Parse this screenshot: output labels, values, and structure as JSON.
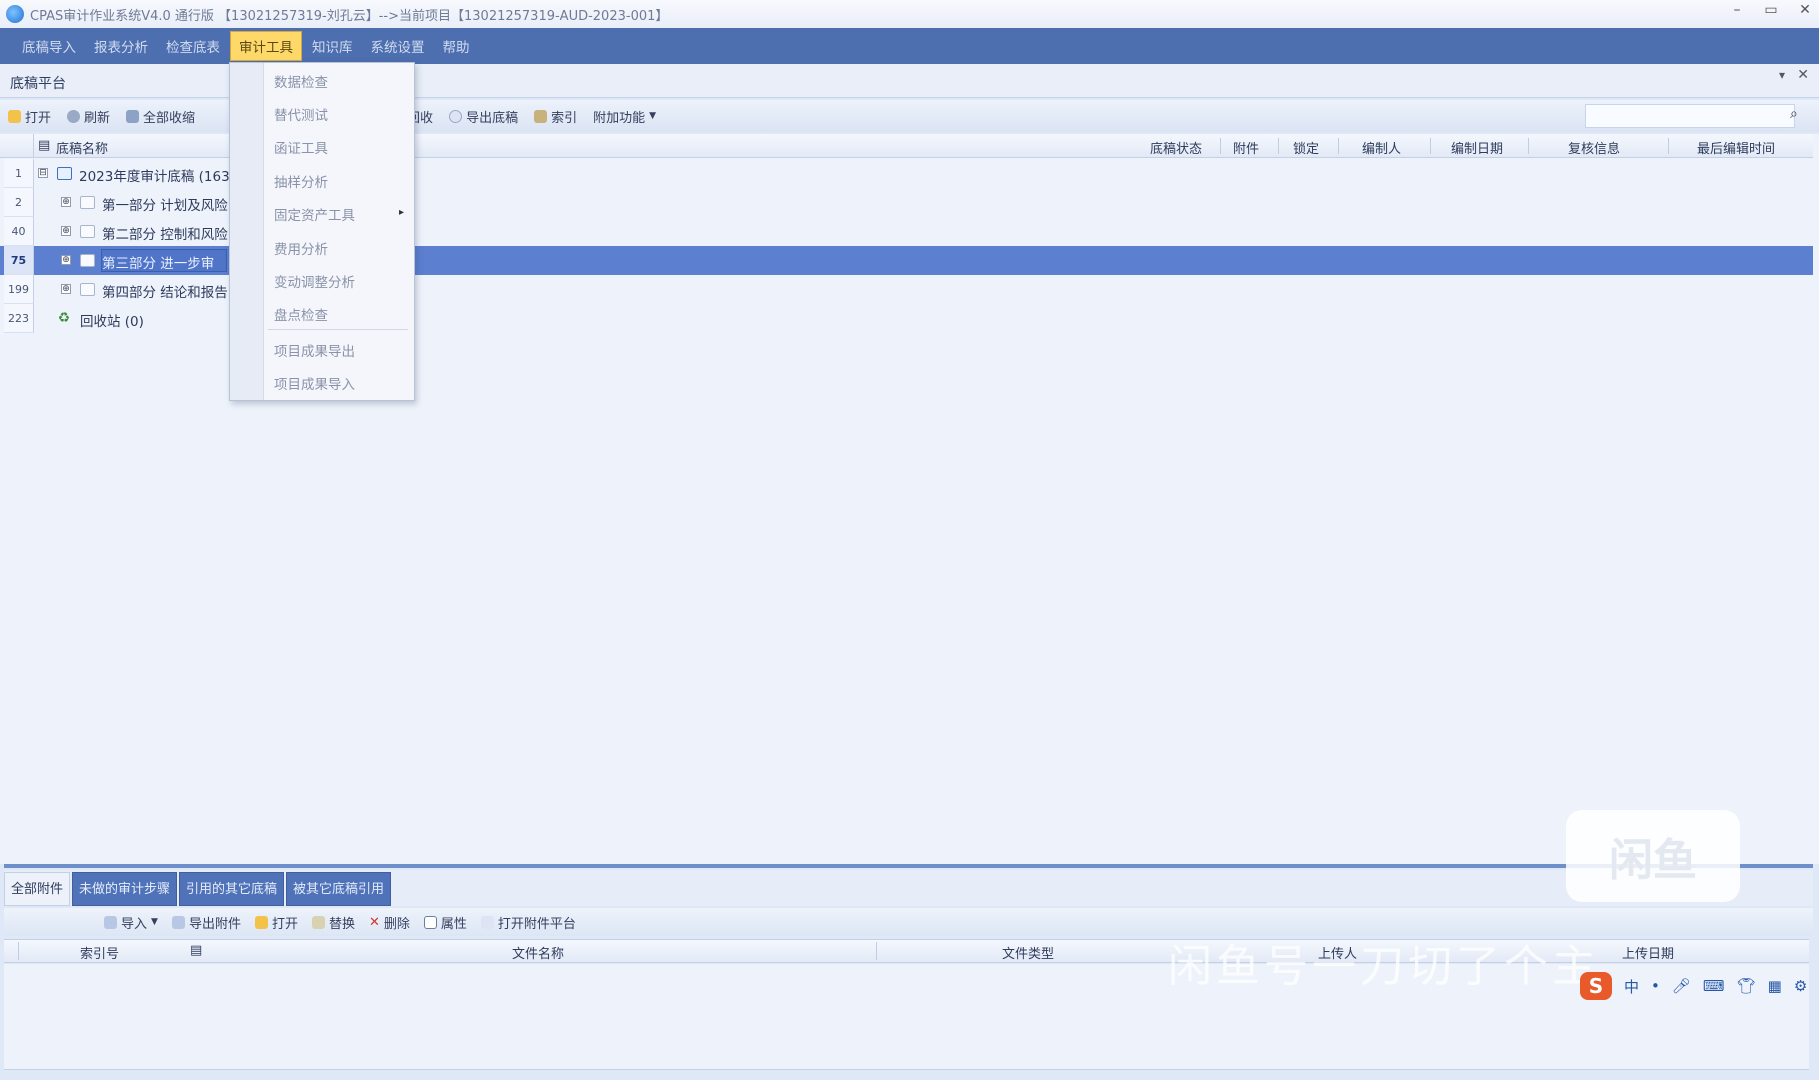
{
  "titlebar": {
    "title": "CPAS审计作业系统V4.0 通行版 【13021257319-刘孔云】-->当前项目【13021257319-AUD-2023-001】",
    "minimize": "–",
    "maximize": "▭",
    "close": "✕"
  },
  "menu": {
    "items": [
      "底稿导入",
      "报表分析",
      "检查底表",
      "审计工具",
      "知识库",
      "系统设置",
      "帮助"
    ]
  },
  "panel": {
    "title": "底稿平台",
    "pin": "▾",
    "close": "✕"
  },
  "toolbar": {
    "open": "打开",
    "refresh": "刷新",
    "collapse_all": "全部收缩",
    "back": "回收",
    "export_workpaper": "导出底稿",
    "index": "索引",
    "extra": "附加功能"
  },
  "grid": {
    "columns": {
      "name": "底稿名称",
      "status": "底稿状态",
      "attachment": "附件",
      "lock": "锁定",
      "preparer": "编制人",
      "prep_date": "编制日期",
      "review": "复核信息",
      "last_edit": "最后编辑时间"
    },
    "rows": [
      {
        "num": "1",
        "expander": "⊟",
        "label": "2023年度审计底稿 (163"
      },
      {
        "num": "2",
        "expander": "⊕",
        "label": "第一部分  计划及风险"
      },
      {
        "num": "40",
        "expander": "⊕",
        "label": "第二部分  控制和风险"
      },
      {
        "num": "75",
        "expander": "⊕",
        "label": "第三部分  进一步审"
      },
      {
        "num": "199",
        "expander": "⊕",
        "label": "第四部分  结论和报告"
      },
      {
        "num": "223",
        "expander": "",
        "label": "回收站  (0)"
      }
    ]
  },
  "dropdown": {
    "items": [
      "数据检查",
      "替代测试",
      "函证工具",
      "抽样分析",
      "固定资产工具",
      "费用分析",
      "变动调整分析",
      "盘点检查",
      "项目成果导出",
      "项目成果导入"
    ],
    "submenu_arrow": "▸"
  },
  "bottom": {
    "tabs": [
      "全部附件",
      "未做的审计步骤",
      "引用的其它底稿",
      "被其它底稿引用"
    ],
    "toolbar": {
      "import": "导入",
      "export_attachment": "导出附件",
      "open": "打开",
      "replace": "替换",
      "delete": "删除",
      "properties": "属性",
      "open_platform": "打开附件平台"
    },
    "columns": {
      "index": "索引号",
      "filename": "文件名称",
      "filetype": "文件类型",
      "person": "上传人",
      "date": "上传日期"
    }
  },
  "watermark": {
    "logo": "闲鱼",
    "text": "闲鱼号一刀切了个主"
  },
  "ime": {
    "logo": "S",
    "mode": "中"
  },
  "colors": {
    "menubar": "#4d6fb0",
    "menu_active": "#ffd86a",
    "selection": "#5c7fcf",
    "background": "#dfe8f6"
  }
}
